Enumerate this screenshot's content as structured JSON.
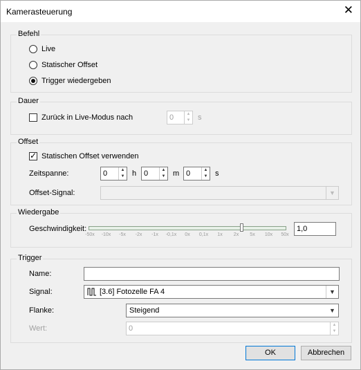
{
  "window": {
    "title": "Kamerasteuerung",
    "close_glyph": "✕"
  },
  "befehl": {
    "legend": "Befehl",
    "options": [
      {
        "label": "Live",
        "selected": false
      },
      {
        "label": "Statischer Offset",
        "selected": false
      },
      {
        "label": "Trigger wiedergeben",
        "selected": true
      }
    ]
  },
  "dauer": {
    "legend": "Dauer",
    "checkbox_label": "Zurück in Live-Modus nach",
    "checked": false,
    "value": "0",
    "unit": "s"
  },
  "offset": {
    "legend": "Offset",
    "checkbox_label": "Statischen Offset verwenden",
    "checked": true,
    "zeitspanne_label": "Zeitspanne:",
    "hours": "0",
    "hours_unit": "h",
    "minutes": "0",
    "minutes_unit": "m",
    "seconds": "0",
    "seconds_unit": "s",
    "signal_label": "Offset-Signal:",
    "signal_value": ""
  },
  "wiedergabe": {
    "legend": "Wiedergabe",
    "speed_label": "Geschwindigkeit:",
    "speed_value": "1,0",
    "slider_position": 0.78,
    "ticks": [
      "-50x",
      "-10x",
      "-5x",
      "-2x",
      "-1x",
      "-0,1x",
      "0x",
      "0,1x",
      "1x",
      "2x",
      "5x",
      "10x",
      "50x"
    ]
  },
  "trigger": {
    "legend": "Trigger",
    "name_label": "Name:",
    "name_value": "",
    "signal_label": "Signal:",
    "signal_value": "[3.6] Fotozelle FA 4",
    "flanke_label": "Flanke:",
    "flanke_value": "Steigend",
    "wert_label": "Wert:",
    "wert_value": "0"
  },
  "buttons": {
    "ok": "OK",
    "cancel": "Abbrechen"
  },
  "colors": {
    "accent": "#0078d7",
    "dialog_bg": "#f0f0f0"
  }
}
